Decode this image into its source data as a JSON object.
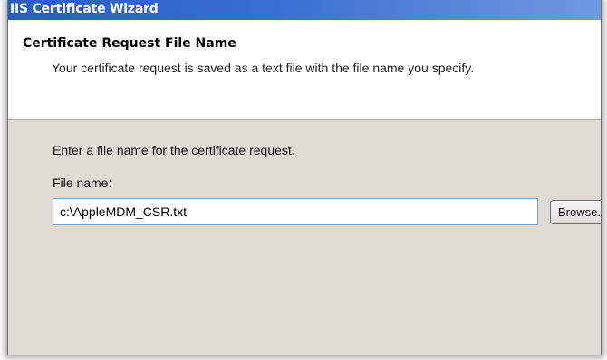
{
  "window": {
    "title": "IIS Certificate Wizard"
  },
  "header": {
    "title": "Certificate Request File Name",
    "description": "Your certificate request is saved as a text file with the file name you specify."
  },
  "main": {
    "instruction": "Enter a file name for the certificate request.",
    "file_name_label": "File name:",
    "file_name_value": "c:\\AppleMDM_CSR.txt",
    "browse_label": "Browse..."
  },
  "colors": {
    "titlebar": "#3a6fd2",
    "dialog_body": "#dfdcd6",
    "header_bg": "#ffffff"
  }
}
